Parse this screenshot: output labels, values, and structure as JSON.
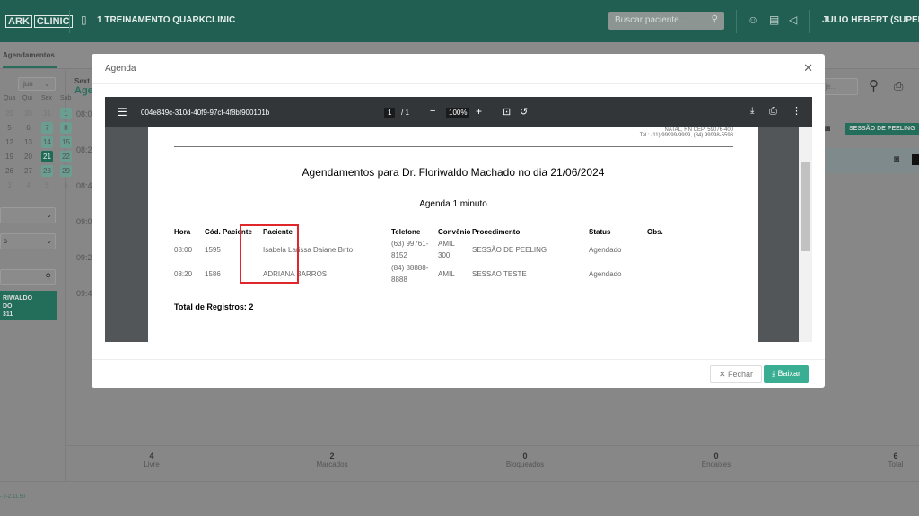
{
  "header": {
    "logo": "ARK",
    "logo_badge": "CLINIC",
    "clinic_name": "1 TREINAMENTO QUARKCLINIC",
    "search_placeholder": "Buscar paciente...",
    "user": "JULIO HEBERT (SUPER US"
  },
  "subnav": {
    "tab": "Agendamentos"
  },
  "sidebar": {
    "month": "jun",
    "weekdays": [
      "Qua",
      "Qui",
      "Sex",
      "Sáb"
    ],
    "weeks": [
      [
        "29",
        "30",
        "31",
        "1"
      ],
      [
        "5",
        "6",
        "7",
        "8"
      ],
      [
        "12",
        "13",
        "14",
        "15"
      ],
      [
        "19",
        "20",
        "21",
        "22"
      ],
      [
        "26",
        "27",
        "28",
        "29"
      ],
      [
        "3",
        "4",
        "5",
        "6"
      ]
    ],
    "selected_day": "21",
    "select2": "s",
    "doctor_card": [
      "RIWALDO",
      "DO",
      "311"
    ]
  },
  "agenda": {
    "day": "Sext",
    "title": "Age",
    "times": [
      "08:0",
      "08:2",
      "08:4",
      "09:0",
      "09:2",
      "09:4"
    ],
    "search_placeholder": "oje...",
    "procedure_badge": "SESSÃO DE PEELING"
  },
  "stats": [
    {
      "value": "4",
      "label": "Livre"
    },
    {
      "value": "2",
      "label": "Marcados"
    },
    {
      "value": "0",
      "label": "Bloqueados"
    },
    {
      "value": "0",
      "label": "Encaixes"
    },
    {
      "value": "6",
      "label": "Total"
    }
  ],
  "footer": {
    "version": "- v-2.11.50"
  },
  "modal": {
    "title": "Agenda",
    "pdf": {
      "filename": "004e849c-310d-40f9-97cf-4f8bf900101b",
      "page_current": "1",
      "page_total": "/ 1",
      "zoom": "100%",
      "address": "NATAL, RN CEP: 59076-400",
      "phone": "Tel.: (11) 99999-9999, (84) 99998-5598",
      "title": "Agendamentos para Dr. Floriwaldo Machado no dia 21/06/2024",
      "subtitle": "Agenda 1 minuto",
      "columns": [
        "Hora",
        "Cód. Paciente",
        "Paciente",
        "Telefone",
        "Convênio",
        "Procedimento",
        "Status",
        "Obs."
      ],
      "rows": [
        [
          "08:00",
          "1595",
          "Isabela Larissa Daiane Brito",
          "(63) 99761-",
          "8152",
          "AMIL",
          "300",
          "SESSÃO DE PEELING",
          "Agendado"
        ],
        [
          "08:20",
          "1586",
          "ADRIANA BARROS",
          "(84) 88888-",
          "8888",
          "AMIL",
          "",
          "SESSAO TESTE",
          "Agendado"
        ]
      ],
      "total": "Total de Registros: 2"
    },
    "close_label": "Fechar",
    "download_label": "Baixar"
  },
  "colors": {
    "brand": "#215f52",
    "accent": "#3aae92",
    "highlight": "#e0262b"
  }
}
